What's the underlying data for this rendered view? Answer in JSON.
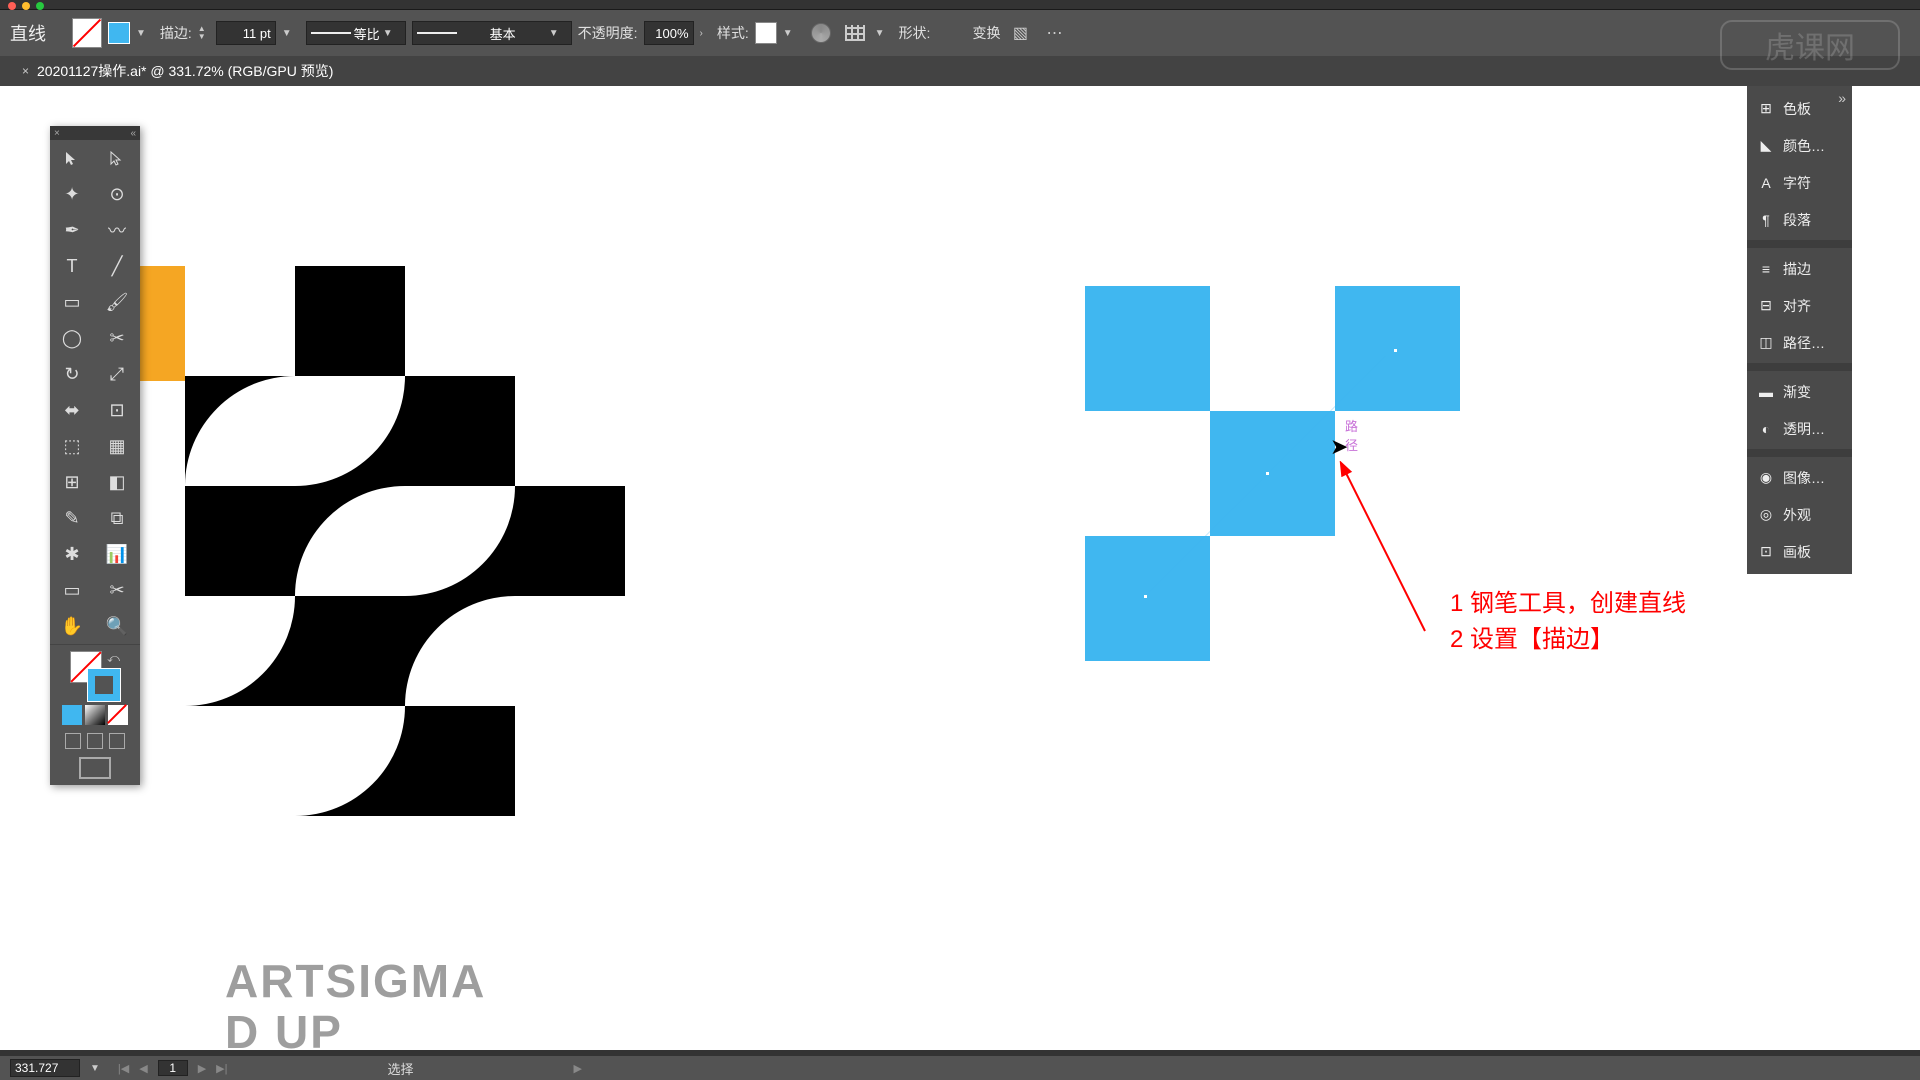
{
  "menu": {},
  "control_bar": {
    "tool_label": "直线",
    "stroke_label": "描边:",
    "stroke_weight": "11 pt",
    "profile_label": "等比",
    "brush_label": "基本",
    "opacity_label": "不透明度:",
    "opacity_value": "100%",
    "style_label": "样式:",
    "align_label": "",
    "shape_label": "形状:",
    "transform_label": "变换"
  },
  "doc_tab": {
    "text": "20201127操作.ai* @ 331.72% (RGB/GPU 预览)"
  },
  "right_panel": {
    "items": [
      {
        "icon": "grid",
        "label": "色板"
      },
      {
        "icon": "swatch",
        "label": "颜色…"
      },
      {
        "icon": "char",
        "label": "字符"
      },
      {
        "icon": "para",
        "label": "段落"
      },
      {
        "div": true
      },
      {
        "icon": "stroke",
        "label": "描边"
      },
      {
        "icon": "align",
        "label": "对齐"
      },
      {
        "icon": "path",
        "label": "路径…"
      },
      {
        "div": true
      },
      {
        "icon": "grad",
        "label": "渐变"
      },
      {
        "icon": "transp",
        "label": "透明…"
      },
      {
        "div": true
      },
      {
        "icon": "img",
        "label": "图像…"
      },
      {
        "icon": "appear",
        "label": "外观"
      },
      {
        "icon": "artb",
        "label": "画板"
      }
    ]
  },
  "canvas": {
    "brand_line1": "ARTSIGMA",
    "brand_line2": "D UP",
    "guide_label": "路径",
    "annotation_line1": "1 钢笔工具，创建直线",
    "annotation_line2": "2 设置【描边】"
  },
  "status": {
    "zoom": "331.727",
    "artboard": "1",
    "tool_hint": "选择"
  },
  "watermark": "虎课网",
  "colors": {
    "accent": "#40b7f0",
    "orange": "#f5a623",
    "panel": "#535353"
  }
}
